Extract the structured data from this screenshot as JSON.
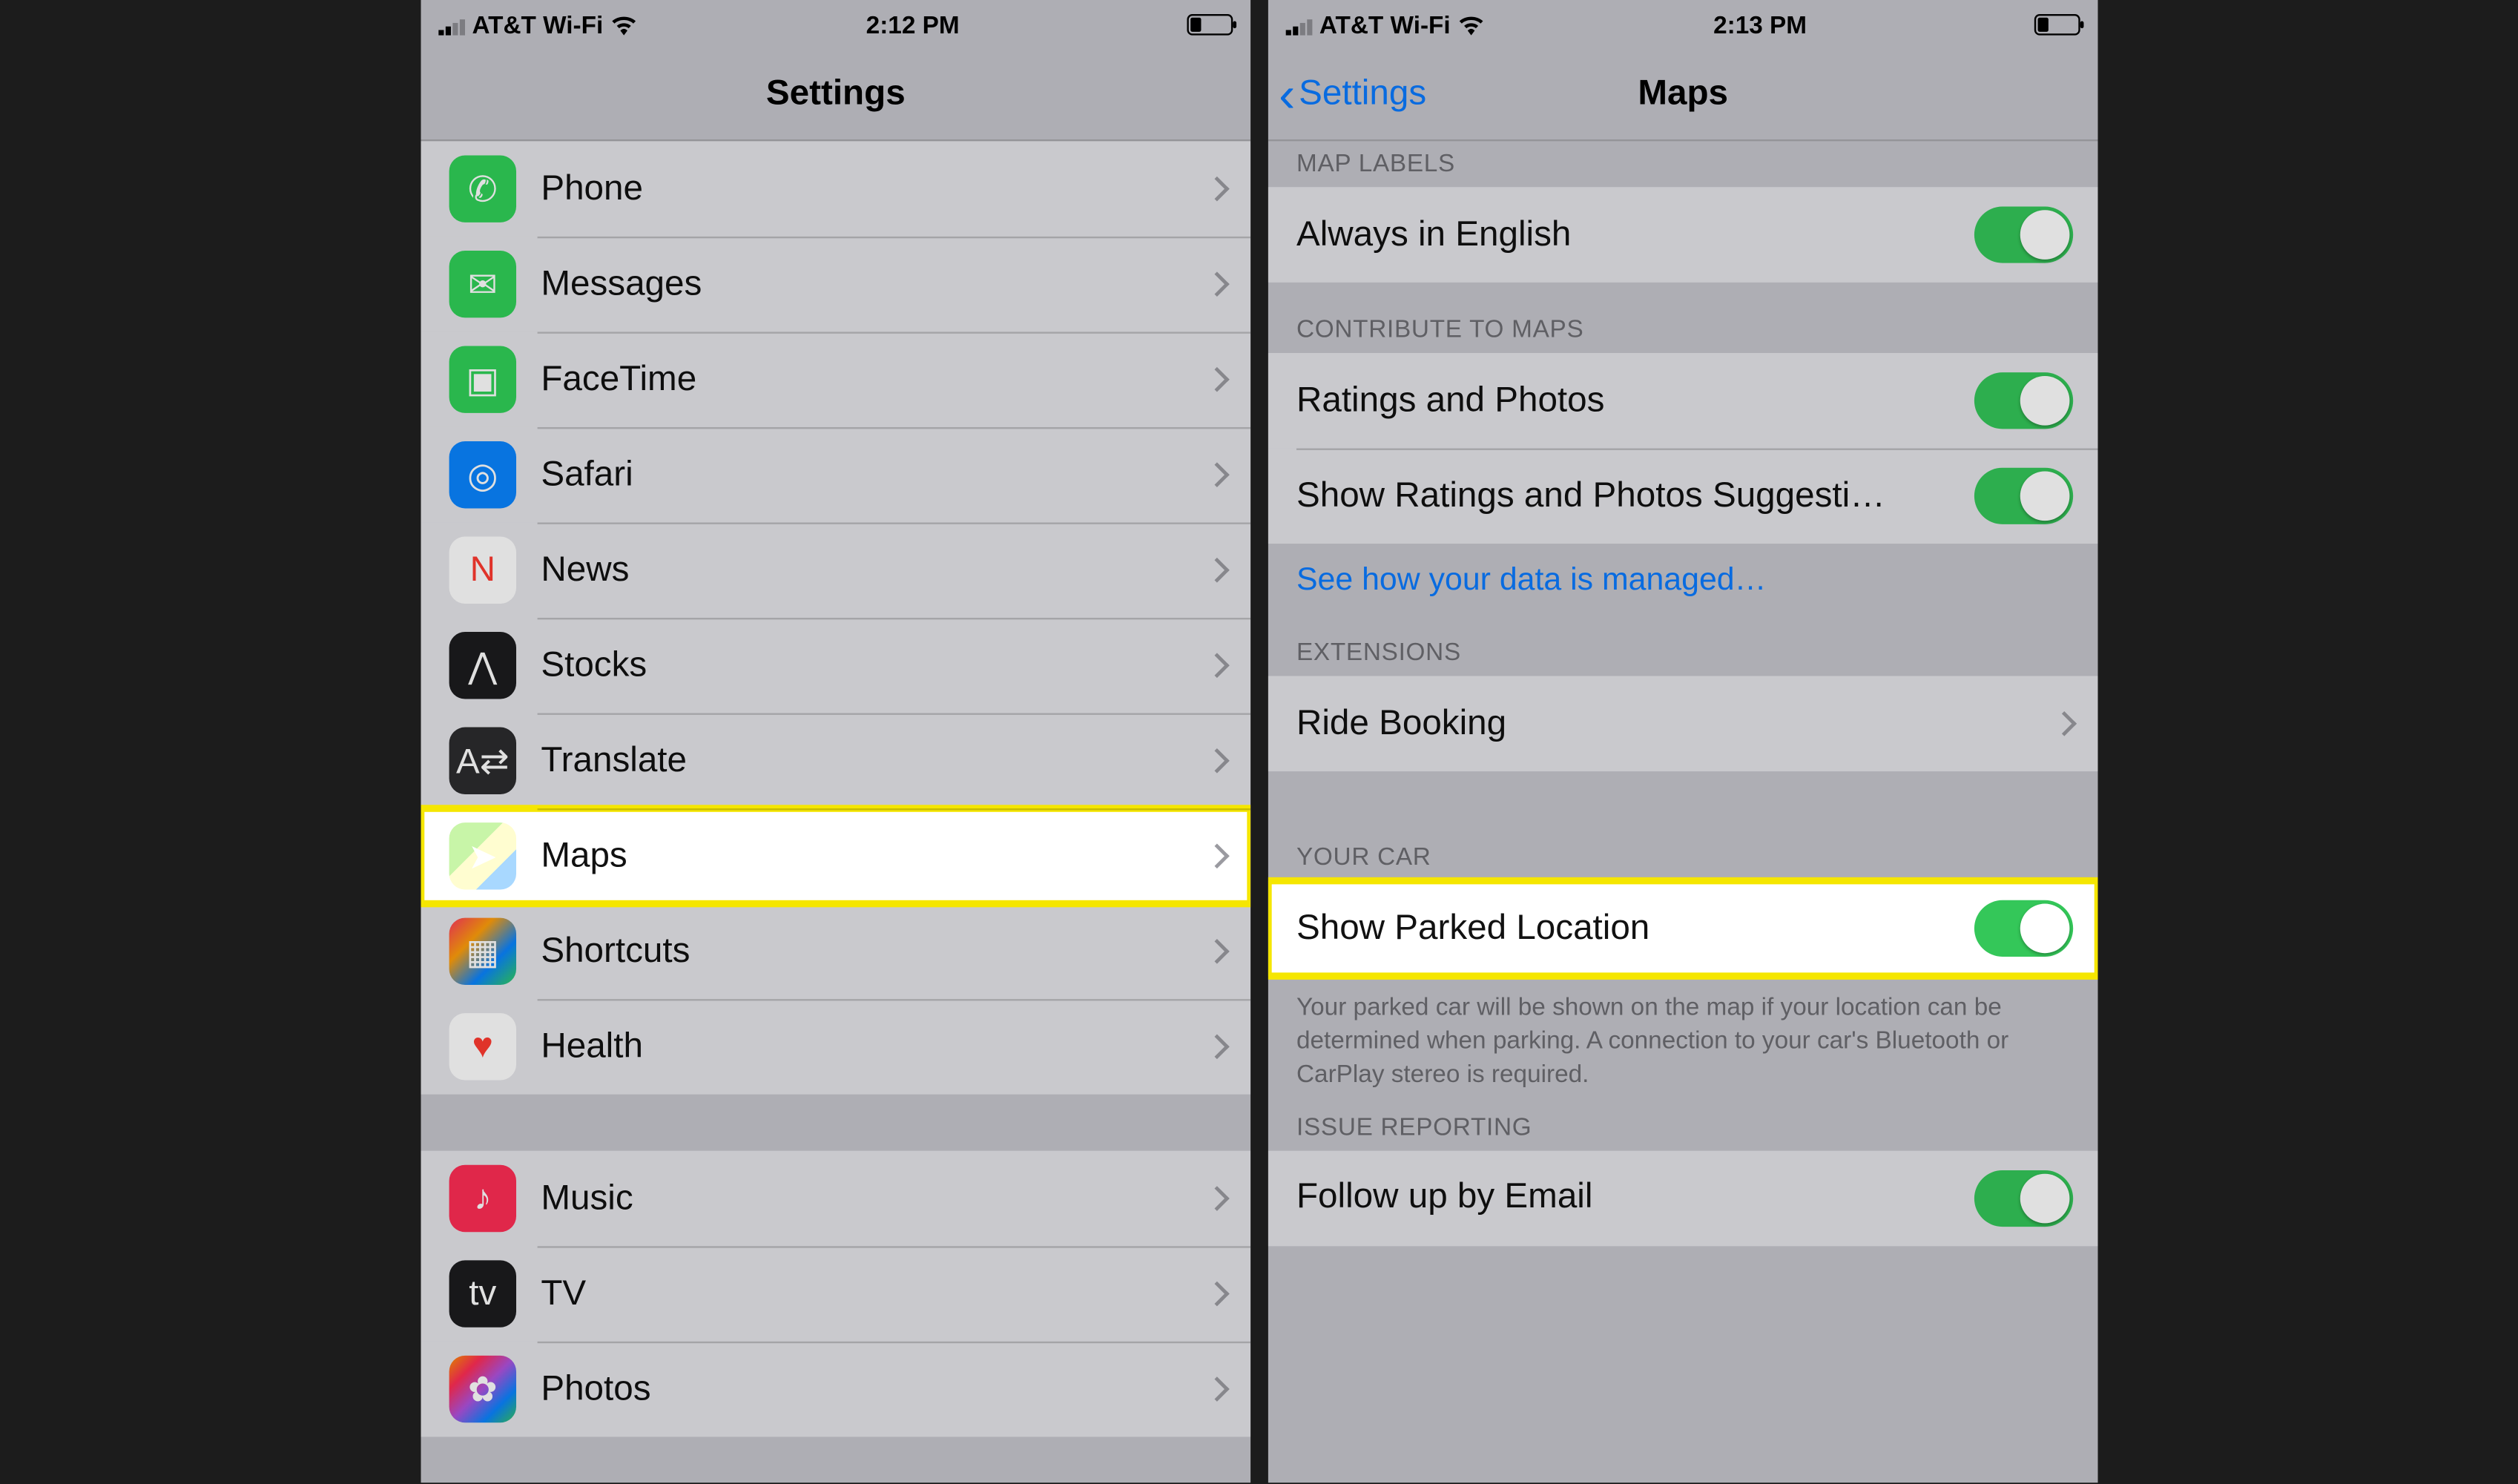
{
  "left": {
    "status": {
      "carrier": "AT&T Wi-Fi",
      "time": "2:12 PM"
    },
    "title": "Settings",
    "group1": [
      {
        "label": "Phone",
        "icon": "phone-icon",
        "bg": "bg-green",
        "glyph": "✆"
      },
      {
        "label": "Messages",
        "icon": "messages-icon",
        "bg": "bg-green",
        "glyph": "✉"
      },
      {
        "label": "FaceTime",
        "icon": "facetime-icon",
        "bg": "bg-green",
        "glyph": "▣"
      },
      {
        "label": "Safari",
        "icon": "safari-icon",
        "bg": "bg-blue",
        "glyph": "◎"
      },
      {
        "label": "News",
        "icon": "news-icon",
        "bg": "bg-news",
        "glyph": "N"
      },
      {
        "label": "Stocks",
        "icon": "stocks-icon",
        "bg": "bg-black",
        "glyph": "⋀"
      },
      {
        "label": "Translate",
        "icon": "translate-icon",
        "bg": "bg-dark",
        "glyph": "A⇄"
      },
      {
        "label": "Maps",
        "icon": "maps-icon",
        "bg": "bg-maps",
        "glyph": "➤",
        "highlight": true
      },
      {
        "label": "Shortcuts",
        "icon": "shortcuts-icon",
        "bg": "bg-short",
        "glyph": "▦"
      },
      {
        "label": "Health",
        "icon": "health-icon",
        "bg": "bg-white",
        "glyph": "♥"
      }
    ],
    "group2": [
      {
        "label": "Music",
        "icon": "music-icon",
        "bg": "bg-pink",
        "glyph": "♪"
      },
      {
        "label": "TV",
        "icon": "tv-icon",
        "bg": "bg-black",
        "glyph": "tv"
      },
      {
        "label": "Photos",
        "icon": "photos-icon",
        "bg": "bg-grad",
        "glyph": "✿"
      }
    ]
  },
  "right": {
    "status": {
      "carrier": "AT&T Wi-Fi",
      "time": "2:13 PM"
    },
    "back": "Settings",
    "title": "Maps",
    "sections": {
      "mapLabels": {
        "header": "MAP LABELS",
        "rows": [
          {
            "label": "Always in English",
            "on": true
          }
        ]
      },
      "contribute": {
        "header": "CONTRIBUTE TO MAPS",
        "rows": [
          {
            "label": "Ratings and Photos",
            "on": true
          },
          {
            "label": "Show Ratings and Photos Suggesti…",
            "on": true
          }
        ],
        "link": "See how your data is managed…"
      },
      "extensions": {
        "header": "EXTENSIONS",
        "rows": [
          {
            "label": "Ride Booking"
          }
        ]
      },
      "yourCar": {
        "header": "YOUR CAR",
        "rows": [
          {
            "label": "Show Parked Location",
            "on": true,
            "highlight": true
          }
        ],
        "footer": "Your parked car will be shown on the map if your location can be determined when parking. A connection to your car's Bluetooth or CarPlay stereo is required."
      },
      "issue": {
        "header": "ISSUE REPORTING",
        "rows": [
          {
            "label": "Follow up by Email",
            "on": true
          }
        ]
      }
    }
  }
}
